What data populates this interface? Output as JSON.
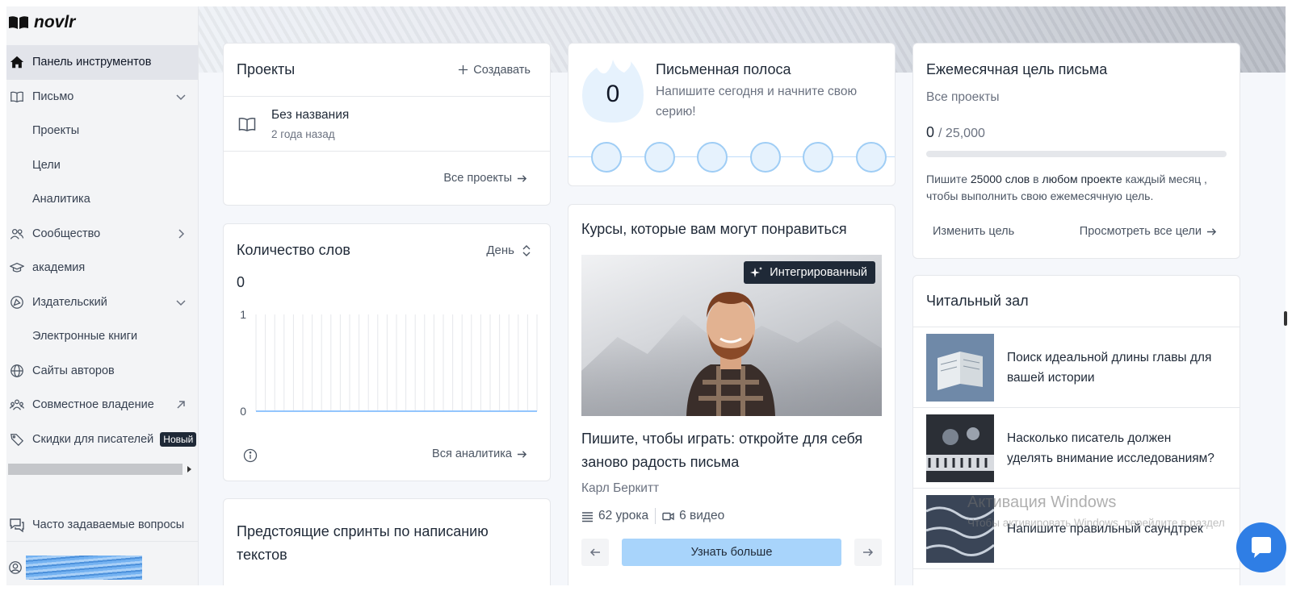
{
  "brand": {
    "name": "novlr"
  },
  "sidebar": {
    "items": [
      {
        "label": "Панель инструментов",
        "icon": "home-icon",
        "active": true
      },
      {
        "label": "Письмо",
        "icon": "book-open-icon",
        "expandable": "down"
      },
      {
        "label": "Проекты",
        "sub": true
      },
      {
        "label": "Цели",
        "sub": true
      },
      {
        "label": "Аналитика",
        "sub": true
      },
      {
        "label": "Сообщество",
        "icon": "users-icon",
        "expandable": "right"
      },
      {
        "label": "академия",
        "icon": "graduation-cap-icon"
      },
      {
        "label": "Издательский",
        "icon": "publish-icon",
        "expandable": "down"
      },
      {
        "label": "Электронные книги",
        "sub": true
      },
      {
        "label": "Сайты авторов",
        "icon": "globe-icon"
      },
      {
        "label": "Совместное владение",
        "icon": "group-icon",
        "external": true
      },
      {
        "label": "Скидки для писателей",
        "icon": "tag-icon",
        "badge": "Новый"
      }
    ],
    "faq_label": "Часто задаваемые вопросы"
  },
  "projects": {
    "title": "Проекты",
    "create_label": "Создавать",
    "items": [
      {
        "name": "Без названия",
        "time": "2 года назад"
      }
    ],
    "all_label": "Все проекты"
  },
  "word_count": {
    "title": "Количество слов",
    "period": "День",
    "total": "0",
    "all_label": "Вся аналитика"
  },
  "chart_data": {
    "type": "bar",
    "categories": [],
    "values": [
      0,
      0,
      0,
      0,
      0,
      0,
      0,
      0,
      0,
      0,
      0,
      0,
      0,
      0,
      0,
      0,
      0,
      0,
      0,
      0,
      0,
      0,
      0,
      0,
      0,
      0,
      0,
      0,
      0,
      0,
      0
    ],
    "ylim": [
      0,
      1
    ],
    "yticks": [
      "1",
      "0"
    ],
    "grid": true
  },
  "sprints": {
    "title": "Предстоящие спринты по написанию текстов"
  },
  "streak": {
    "count": "0",
    "title": "Письменная полоса",
    "subtitle": "Напишите сегодня и начните свою серию!",
    "days": 6
  },
  "courses": {
    "title": "Курсы, которые вам могут понравиться",
    "tag": "Интегрированный",
    "course_name": "Пишите, чтобы играть: откройте для себя заново радость письма",
    "author": "Карл Беркитт",
    "lessons": "62 урока",
    "videos": "6 видео",
    "learn_label": "Узнать больше"
  },
  "goal": {
    "title": "Ежемесячная цель письма",
    "scope": "Все проекты",
    "current": "0",
    "target": "25,000",
    "progress": 0,
    "desc_pre": "Пишите",
    "desc_words": "25000 слов",
    "desc_in": "в",
    "desc_project": "любом проекте",
    "desc_post": "каждый месяц , чтобы выполнить свою ежемесячную цель.",
    "change_label": "Изменить цель",
    "view_all_label": "Просмотреть все цели"
  },
  "reading_room": {
    "title": "Читальный зал",
    "items": [
      {
        "title": "Поиск идеальной длины главы для вашей истории"
      },
      {
        "title": "Насколько писатель должен уделять внимание исследованиям?"
      },
      {
        "title": "Напишите правильный саундтрек"
      }
    ]
  },
  "watermark": {
    "line1": "Активация Windows",
    "line2": "Чтобы активировать Windows, перейдите в раздел"
  },
  "colors": {
    "accent": "#a8d4fb",
    "streak_dot": "#9fcdf5",
    "chat": "#2f7ee5"
  }
}
